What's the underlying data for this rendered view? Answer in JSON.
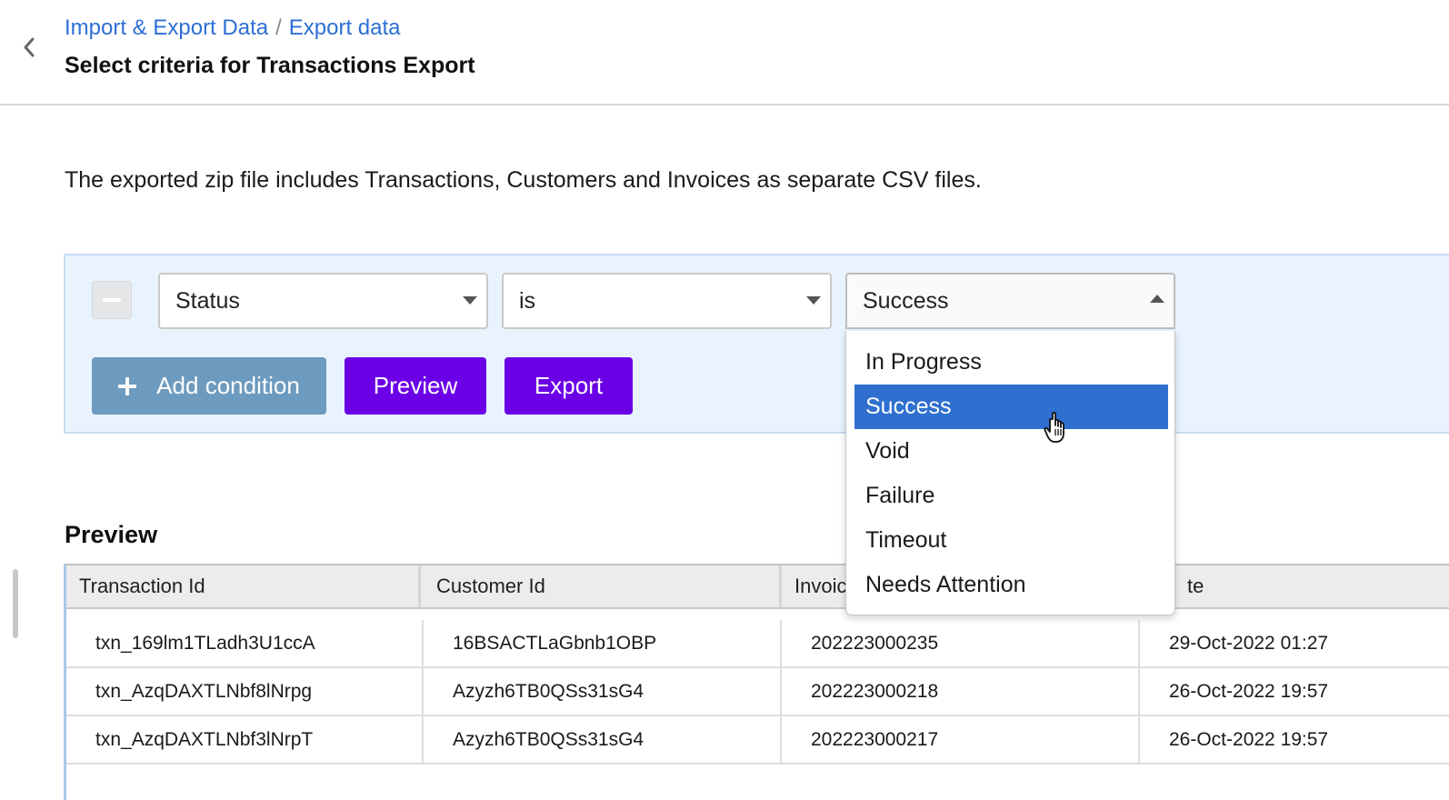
{
  "header": {
    "back_icon": "chevron-left-icon",
    "breadcrumb": {
      "items": [
        "Import & Export Data",
        "Export data"
      ],
      "separator": "/"
    },
    "title": "Select criteria for Transactions Export"
  },
  "description": "The exported zip file includes Transactions, Customers and Invoices as separate CSV files.",
  "criteria": {
    "remove_icon": "minus-icon",
    "field_select": {
      "value": "Status"
    },
    "operator_select": {
      "value": "is"
    },
    "value_select": {
      "value": "Success",
      "open": true,
      "options": [
        "In Progress",
        "Success",
        "Void",
        "Failure",
        "Timeout",
        "Needs Attention"
      ],
      "highlighted": "Success"
    },
    "buttons": {
      "add_condition": "Add condition",
      "preview": "Preview",
      "export": "Export"
    }
  },
  "preview": {
    "title": "Preview",
    "columns": [
      "Transaction Id",
      "Customer Id",
      "Invoic",
      "te"
    ],
    "rows": [
      [
        "txn_169lm1TLadh3U1ccA",
        "16BSACTLaGbnb1OBP",
        "202223000235",
        "29-Oct-2022 01:27"
      ],
      [
        "txn_AzqDAXTLNbf8lNrpg",
        "Azyzh6TB0QSs31sG4",
        "202223000218",
        "26-Oct-2022 19:57"
      ],
      [
        "txn_AzqDAXTLNbf3lNrpT",
        "Azyzh6TB0QSs31sG4",
        "202223000217",
        "26-Oct-2022 19:57"
      ]
    ]
  },
  "colors": {
    "link": "#2d6fd6",
    "primary_button": "#6b00e6",
    "secondary_button": "#6d9bbf",
    "panel_bg": "#e8f3fd",
    "selected_option": "#2f6fcf"
  }
}
